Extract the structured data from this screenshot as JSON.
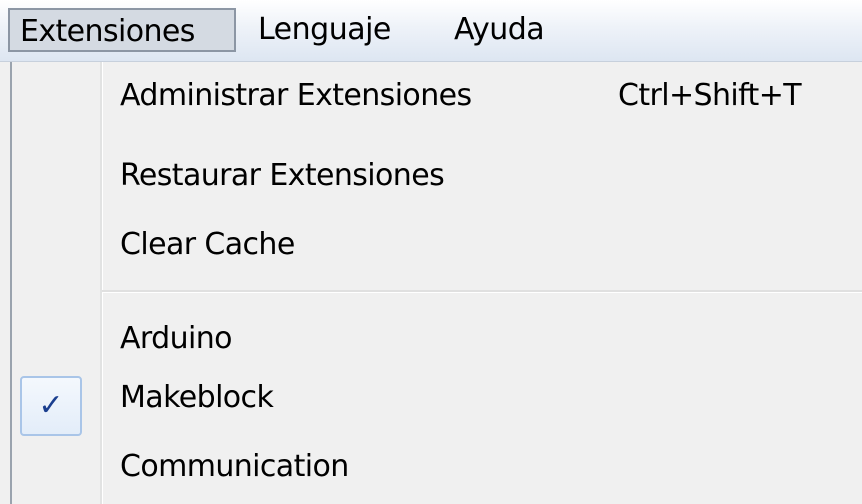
{
  "menubar": {
    "items": [
      {
        "label": "Extensiones",
        "active": true
      },
      {
        "label": "Lenguaje",
        "active": false
      },
      {
        "label": "Ayuda",
        "active": false
      }
    ]
  },
  "dropdown": {
    "groups": [
      {
        "items": [
          {
            "label": "Administrar Extensiones",
            "shortcut": "Ctrl+Shift+T"
          },
          {
            "label": "Restaurar Extensiones",
            "shortcut": ""
          },
          {
            "label": "Clear Cache",
            "shortcut": ""
          }
        ]
      },
      {
        "items": [
          {
            "label": "Arduino",
            "checked": false
          },
          {
            "label": "Makeblock",
            "checked": true
          },
          {
            "label": "Communication",
            "checked": false
          }
        ]
      }
    ],
    "check_glyph": "✓"
  },
  "colors": {
    "menubar_active_bg": "#d4dae2",
    "check_border": "#a9c5e8",
    "check_color": "#1b3f8f"
  }
}
